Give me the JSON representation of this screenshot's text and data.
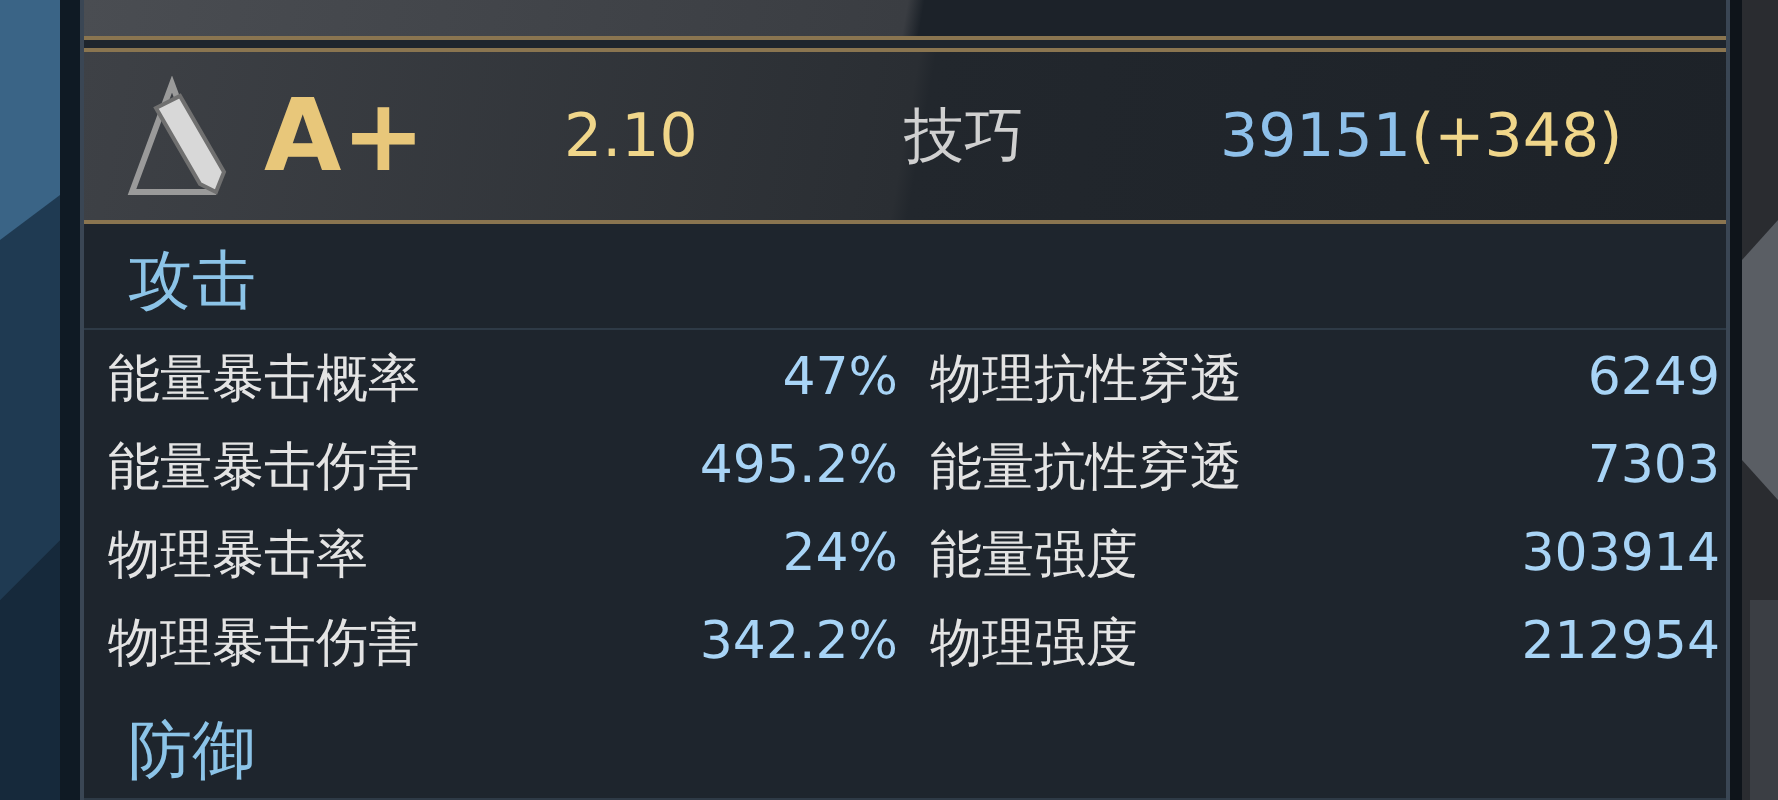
{
  "rating": {
    "grade": "A+",
    "multiplier": "2.10",
    "stat_name": "技巧",
    "stat_value": "39151",
    "stat_bonus": "(+348)"
  },
  "sections": [
    {
      "title": "攻击",
      "stats": [
        {
          "label": "能量暴击概率",
          "value": "47%"
        },
        {
          "label": "物理抗性穿透",
          "value": "6249"
        },
        {
          "label": "能量暴击伤害",
          "value": "495.2%"
        },
        {
          "label": "能量抗性穿透",
          "value": "7303"
        },
        {
          "label": "物理暴击率",
          "value": "24%"
        },
        {
          "label": "能量强度",
          "value": "303914"
        },
        {
          "label": "物理暴击伤害",
          "value": "342.2%"
        },
        {
          "label": "物理强度",
          "value": "212954"
        }
      ]
    },
    {
      "title": "防御"
    }
  ]
}
